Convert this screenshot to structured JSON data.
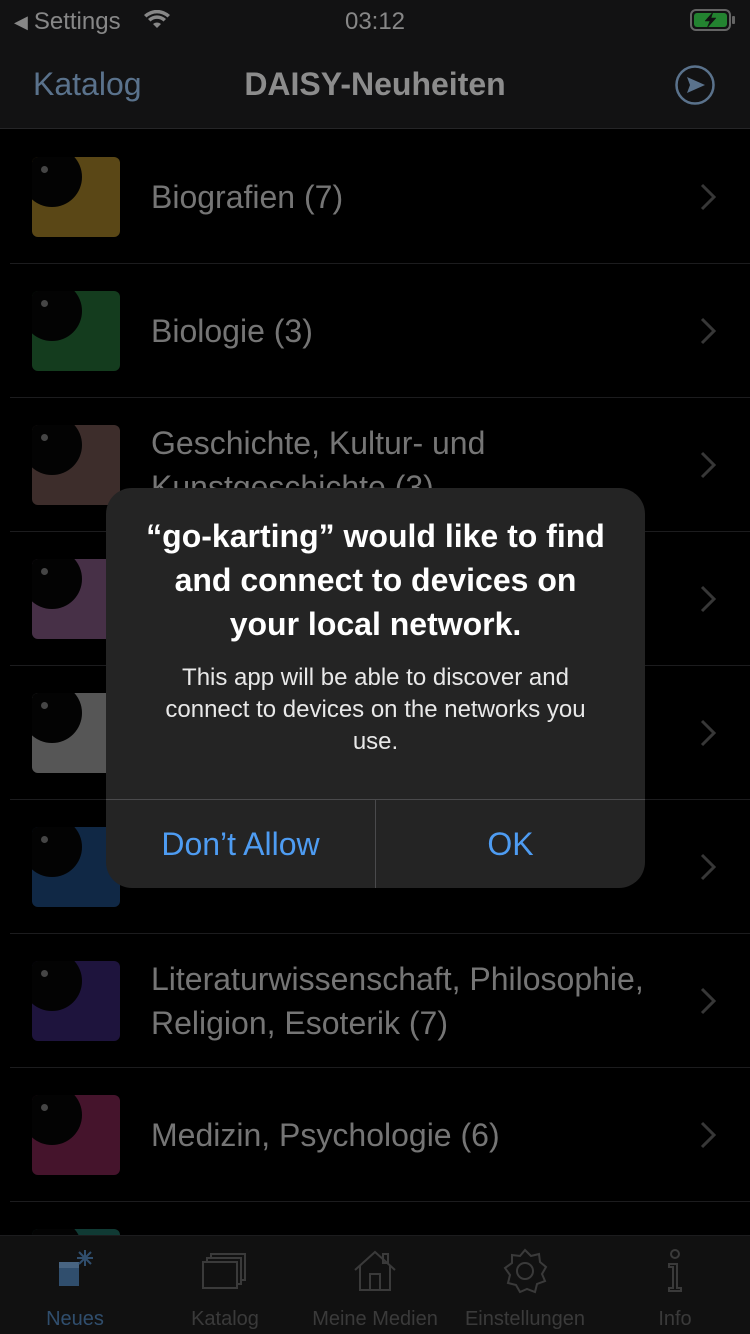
{
  "status_bar": {
    "back_label": "Settings",
    "time": "03:12"
  },
  "nav": {
    "back_label": "Katalog",
    "title": "DAISY-Neuheiten"
  },
  "list": {
    "items": [
      {
        "label": "Biografien (7)",
        "color": "#8a6d22"
      },
      {
        "label": "Biologie (3)",
        "color": "#1f5c2e"
      },
      {
        "label": "Geschichte, Kultur- und Kunstgeschichte (3)",
        "color": "#5e4643"
      },
      {
        "label": "",
        "color": "#6e4a6e"
      },
      {
        "label": "",
        "color": "#858585"
      },
      {
        "label": "",
        "color": "#1a3e6a"
      },
      {
        "label": "Literaturwissenschaft, Philosophie, Religion, Esoterik (7)",
        "color": "#2e1f5e"
      },
      {
        "label": "Medizin, Psychologie (6)",
        "color": "#6a1f44"
      },
      {
        "label": "",
        "color": "#1a5a50"
      }
    ]
  },
  "alert": {
    "title": "“go-karting” would like to find and connect to devices on your local network.",
    "message": "This app will be able to discover and connect to devices on the networks you use.",
    "deny_label": "Don’t Allow",
    "ok_label": "OK"
  },
  "tabs": [
    {
      "label": "Neues"
    },
    {
      "label": "Katalog"
    },
    {
      "label": "Meine Medien"
    },
    {
      "label": "Einstellungen"
    },
    {
      "label": "Info"
    }
  ]
}
